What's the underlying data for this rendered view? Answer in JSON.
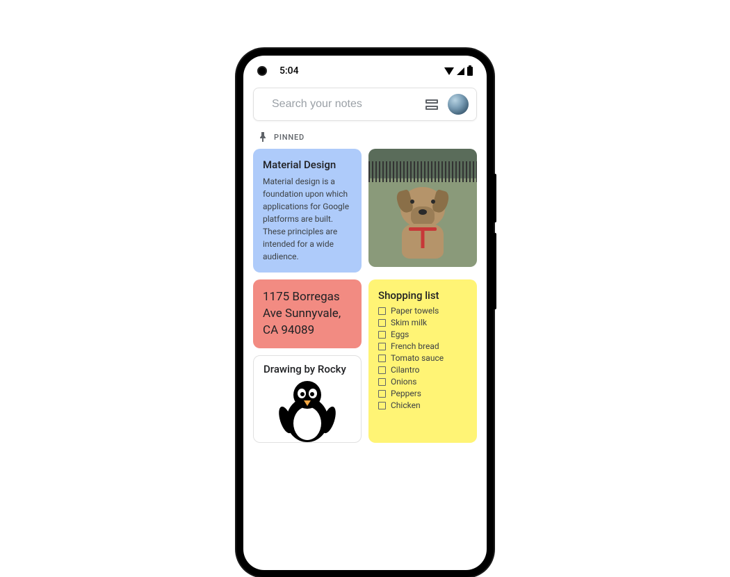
{
  "status_bar": {
    "time": "5:04"
  },
  "search": {
    "placeholder": "Search your notes"
  },
  "section": {
    "pinned_label": "PINNED"
  },
  "notes": {
    "material": {
      "title": "Material Design",
      "body": "Material design is a foundation upon which applications for Google platforms are built. These principles are intended for a wide audience."
    },
    "address": {
      "text": "1175 Borregas Ave Sunnyvale, CA 94089"
    },
    "drawing": {
      "title": "Drawing by Rocky"
    },
    "shopping": {
      "title": "Shopping list",
      "items": [
        "Paper towels",
        "Skim milk",
        "Eggs",
        "French bread",
        "Tomato sauce",
        "Cilantro",
        "Onions",
        "Peppers",
        "Chicken"
      ]
    }
  },
  "colors": {
    "note_blue": "#aecbfa",
    "note_pink": "#f28b82",
    "note_yellow": "#fff475"
  }
}
